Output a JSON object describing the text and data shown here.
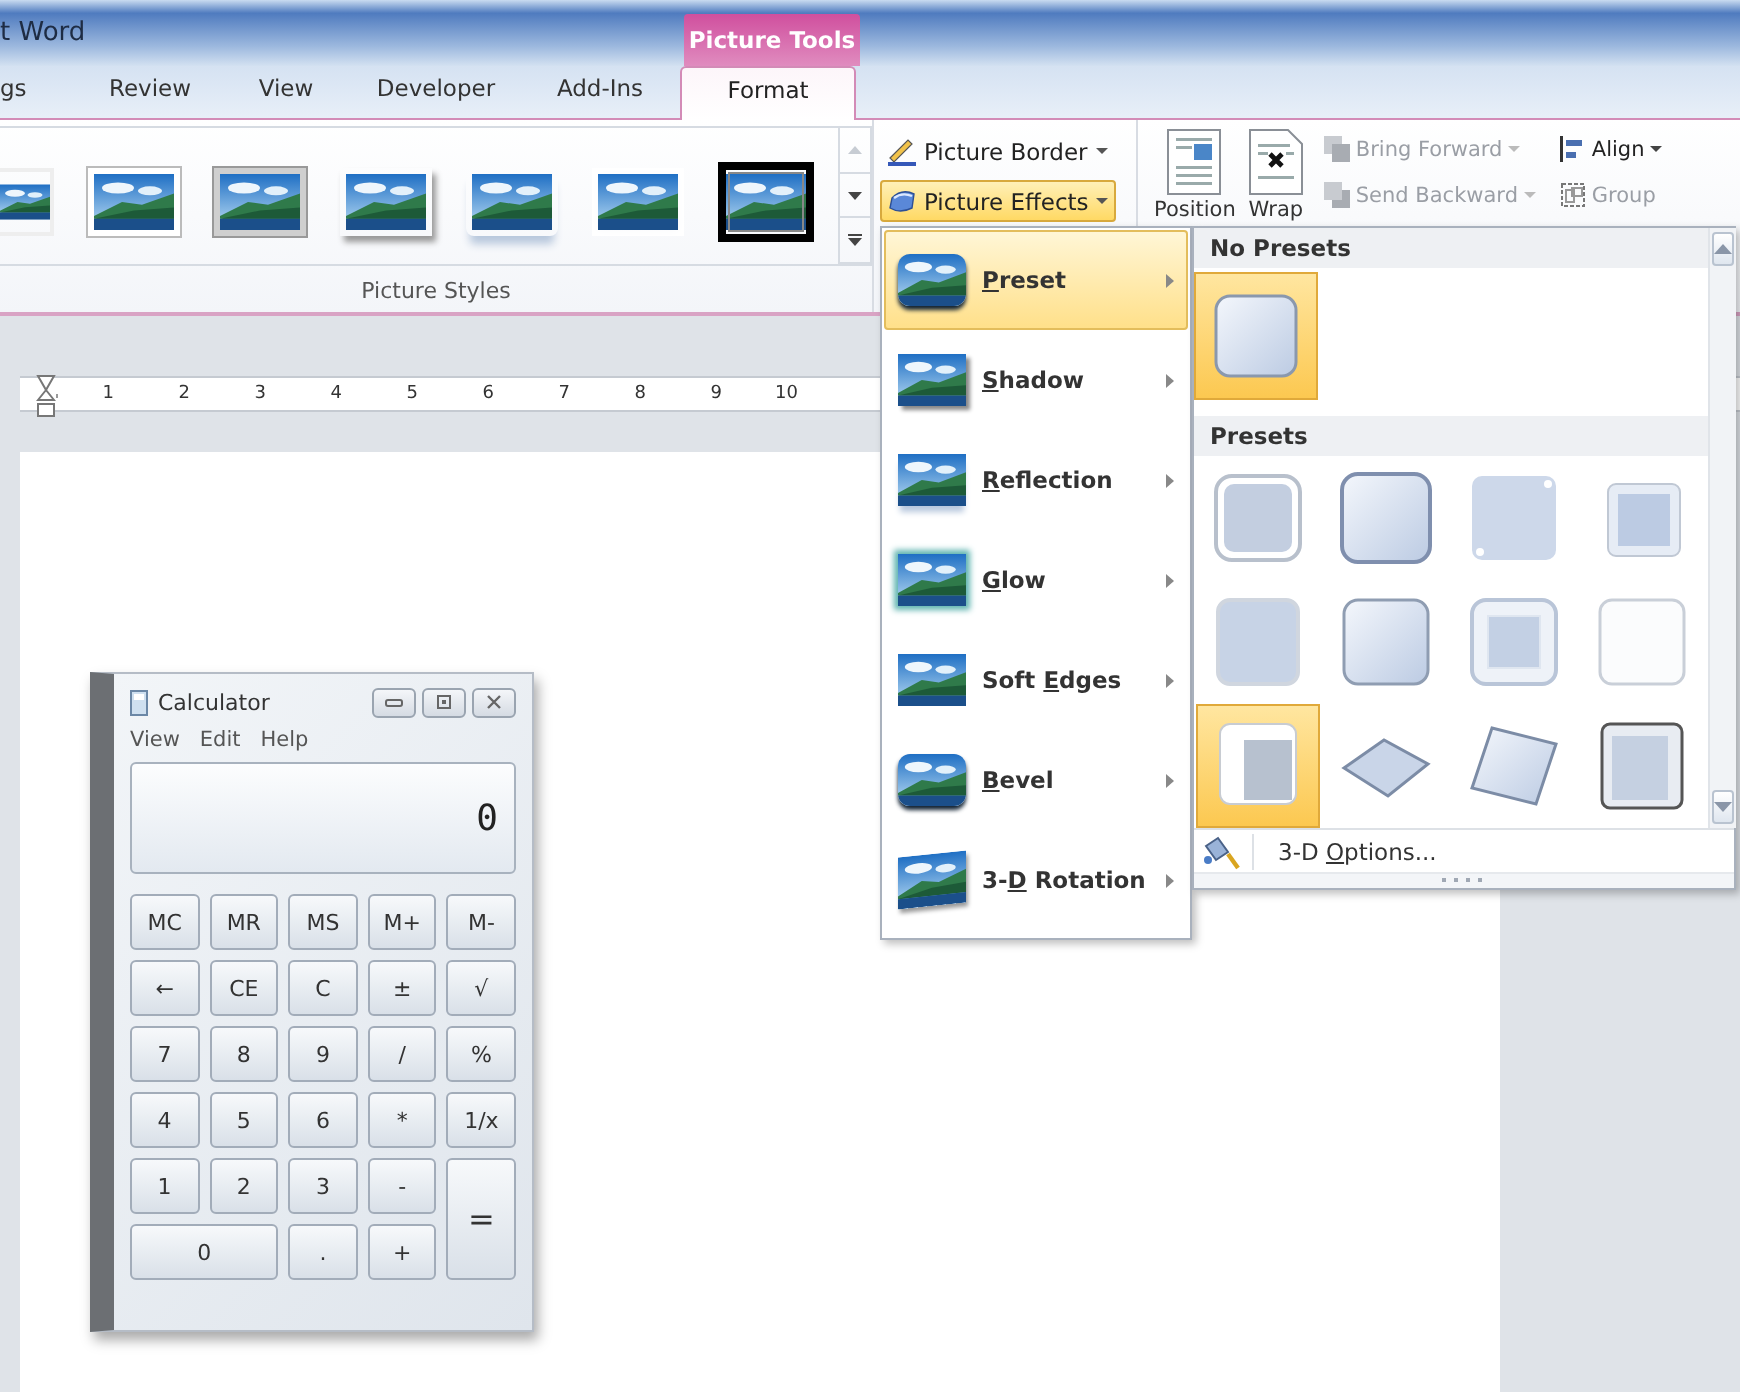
{
  "title_bar": {
    "title": "t Word",
    "context_header": "Picture Tools"
  },
  "tabs": [
    {
      "label": "gs",
      "selected": false
    },
    {
      "label": "Review",
      "selected": false
    },
    {
      "label": "View",
      "selected": false
    },
    {
      "label": "Developer",
      "selected": false
    },
    {
      "label": "Add-Ins",
      "selected": false
    },
    {
      "label": "Format",
      "selected": true
    }
  ],
  "picture_styles": {
    "label": "Picture Styles",
    "styles": [
      {
        "kind": "cut"
      },
      {
        "kind": "white-frame"
      },
      {
        "kind": "grey-frame"
      },
      {
        "kind": "shadow"
      },
      {
        "kind": "reflection"
      },
      {
        "kind": "soft"
      },
      {
        "kind": "black-frame"
      }
    ]
  },
  "picture_buttons": [
    {
      "kind": "border",
      "label": "Picture Border",
      "open": false
    },
    {
      "kind": "effects",
      "label": "Picture Effects",
      "open": true
    }
  ],
  "arrange_large": [
    {
      "kind": "position",
      "label": "Position"
    },
    {
      "kind": "wrap",
      "label": "Wrap"
    }
  ],
  "arrange_buttons": [
    {
      "kind": "forward",
      "label": "Bring Forward",
      "disabled": true
    },
    {
      "kind": "align",
      "label": "Align",
      "disabled": false
    },
    {
      "kind": "backward",
      "label": "Send Backward",
      "disabled": true
    },
    {
      "kind": "group",
      "label": "Group",
      "disabled": true
    }
  ],
  "ruler": {
    "numbers": [
      "1",
      "2",
      "3",
      "4",
      "5",
      "6",
      "7",
      "8",
      "9",
      "10"
    ]
  },
  "effects_menu": [
    {
      "kind": "preset",
      "key": "P",
      "after": "reset",
      "selected": true
    },
    {
      "kind": "shadow",
      "key": "S",
      "after": "hadow",
      "selected": false
    },
    {
      "kind": "reflection",
      "key": "R",
      "after": "eflection",
      "selected": false
    },
    {
      "kind": "glow",
      "key": "G",
      "after": "low",
      "selected": false
    },
    {
      "kind": "soft",
      "before": "Soft ",
      "key": "E",
      "after": "dges",
      "selected": false
    },
    {
      "kind": "bevel",
      "key": "B",
      "after": "evel",
      "selected": false
    },
    {
      "kind": "rotation",
      "before": "3-",
      "key": "D",
      "after": " Rotation",
      "selected": false
    }
  ],
  "preset_panel": {
    "none_heading": "No Presets",
    "none_selected": true,
    "heading": "Presets",
    "presets": [
      {
        "selected": false
      },
      {
        "selected": false
      },
      {
        "selected": false
      },
      {
        "selected": false
      },
      {
        "selected": false
      },
      {
        "selected": false
      },
      {
        "selected": false
      },
      {
        "selected": false
      },
      {
        "selected": true
      },
      {
        "selected": false
      },
      {
        "selected": false
      },
      {
        "selected": false
      }
    ],
    "options": {
      "before": "3-D ",
      "key": "O",
      "after": "ptions..."
    }
  },
  "calculator": {
    "title": "Calculator",
    "menu": [
      "View",
      "Edit",
      "Help"
    ],
    "display": "0",
    "keys": [
      {
        "label": "MC"
      },
      {
        "label": "MR"
      },
      {
        "label": "MS"
      },
      {
        "label": "M+"
      },
      {
        "label": "M-"
      },
      {
        "label": "←"
      },
      {
        "label": "CE"
      },
      {
        "label": "C"
      },
      {
        "label": "±"
      },
      {
        "label": "√"
      },
      {
        "label": "7"
      },
      {
        "label": "8"
      },
      {
        "label": "9"
      },
      {
        "label": "/"
      },
      {
        "label": "%"
      },
      {
        "label": "4"
      },
      {
        "label": "5"
      },
      {
        "label": "6"
      },
      {
        "label": "*"
      },
      {
        "label": "1/x"
      },
      {
        "label": "1"
      },
      {
        "label": "2"
      },
      {
        "label": "3"
      },
      {
        "label": "-"
      },
      {
        "label": "=",
        "kind": "tall"
      },
      {
        "label": "0",
        "kind": "wide"
      },
      {
        "label": "."
      },
      {
        "label": "+"
      }
    ]
  }
}
